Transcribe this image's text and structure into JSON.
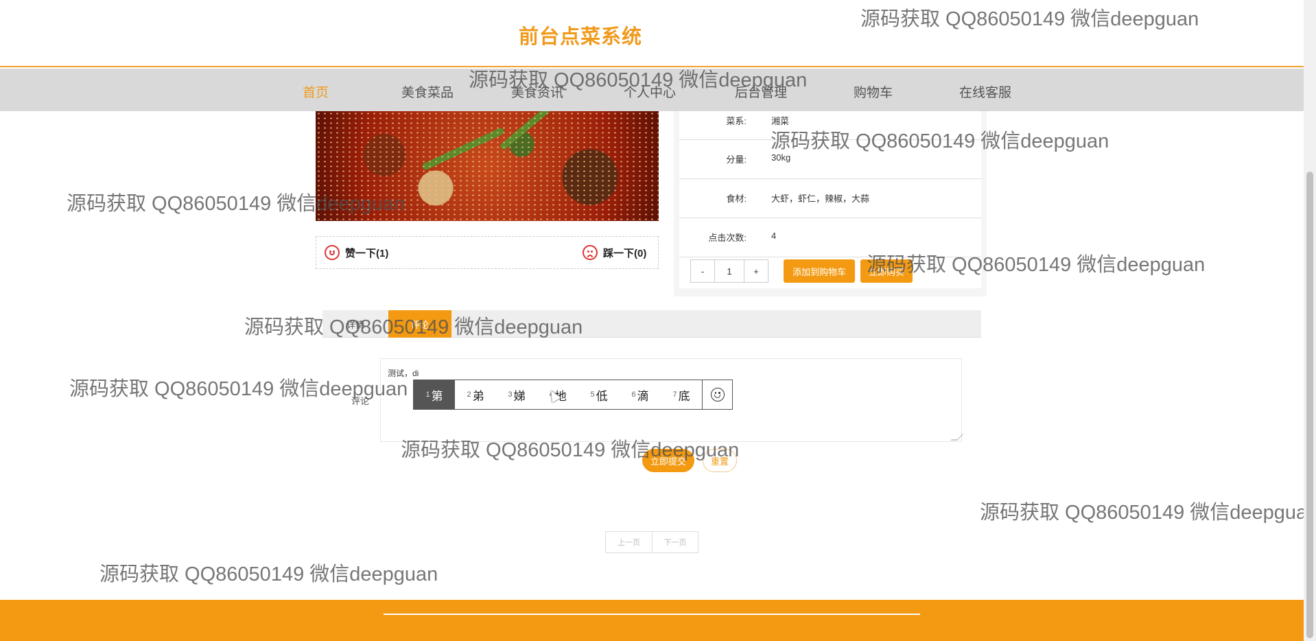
{
  "header": {
    "title": "前台点菜系统"
  },
  "nav": {
    "items": [
      "首页",
      "美食菜品",
      "美食资讯",
      "个人中心",
      "后台管理",
      "购物车",
      "在线客服"
    ]
  },
  "votes": {
    "like_label": "赞一下(1)",
    "dislike_label": "踩一下(0)"
  },
  "details": {
    "rows": [
      {
        "label": "菜系:",
        "value": "湘菜"
      },
      {
        "label": "分量:",
        "value": "30kg"
      },
      {
        "label": "食材:",
        "value": "大虾，虾仁，辣椒，大蒜"
      },
      {
        "label": "点击次数:",
        "value": "4"
      }
    ],
    "quantity": {
      "minus": "-",
      "value": "1",
      "plus": "+"
    },
    "add_to_cart": "添加到购物车",
    "buy_now": "立即购买"
  },
  "tabs": {
    "detail": "详情",
    "comment": "评论"
  },
  "comment": {
    "label": "评论",
    "text": "测试，di"
  },
  "ime": {
    "candidates": [
      {
        "num": "1",
        "char": "第"
      },
      {
        "num": "2",
        "char": "弟"
      },
      {
        "num": "3",
        "char": "娣"
      },
      {
        "num": "4",
        "char": "地"
      },
      {
        "num": "5",
        "char": "低"
      },
      {
        "num": "6",
        "char": "滴"
      },
      {
        "num": "7",
        "char": "底"
      }
    ]
  },
  "form": {
    "submit": "立即提交",
    "reset": "重置"
  },
  "pager": {
    "prev": "上一页",
    "next": "下一页"
  },
  "watermark": {
    "text": "源码获取 QQ86050149 微信deepguan"
  },
  "colors": {
    "accent": "#f39a12",
    "nav_bg": "#d9d9d9"
  }
}
